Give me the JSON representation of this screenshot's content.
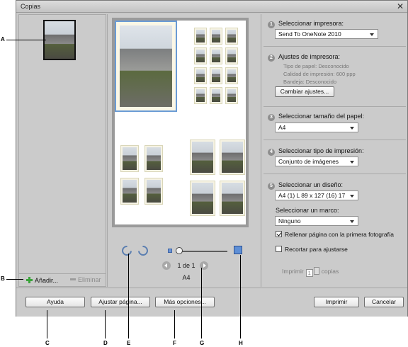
{
  "dialog": {
    "title": "Copias"
  },
  "callouts": [
    "A",
    "B",
    "C",
    "D",
    "E",
    "F",
    "G",
    "H"
  ],
  "left_panel": {
    "add_label": "Añadir...",
    "remove_label": "Eliminar"
  },
  "preview": {
    "page_indicator": "1 de 1",
    "paper_name": "A4"
  },
  "settings": {
    "printer": {
      "step": "1",
      "label": "Seleccionar impresora:",
      "value": "Send To OneNote 2010"
    },
    "printer_settings": {
      "step": "2",
      "label": "Ajustes de impresora:",
      "paper_type": "Tipo de papel: Desconocido",
      "quality": "Calidad de impresión: 600 ppp",
      "tray": "Bandeja: Desconocido",
      "change_button": "Cambiar ajustes..."
    },
    "paper_size": {
      "step": "3",
      "label": "Seleccionar tamaño del papel:",
      "value": "A4"
    },
    "print_type": {
      "step": "4",
      "label": "Seleccionar tipo de impresión:",
      "value": "Conjunto de imágenes"
    },
    "layout": {
      "step": "5",
      "label": "Seleccionar un diseño:",
      "value": "A4 (1) L 89 x 127 (16) 17",
      "frame_label": "Seleccionar un marco:",
      "frame_value": "Ninguno",
      "fill_page_label": "Rellenar página con la primera fotografía",
      "fill_page_checked": true,
      "crop_label": "Recortar para ajustarse",
      "crop_checked": false
    },
    "copies": {
      "before": "Imprimir",
      "value": "1",
      "after": "copias"
    }
  },
  "footer": {
    "help": "Ayuda",
    "page_setup": "Ajustar página...",
    "more_options": "Más opciones...",
    "print": "Imprimir",
    "cancel": "Cancelar"
  },
  "colors": {
    "accent": "#5e8fd6",
    "selection": "#6a9bd5",
    "add_green": "#3aa33a"
  }
}
